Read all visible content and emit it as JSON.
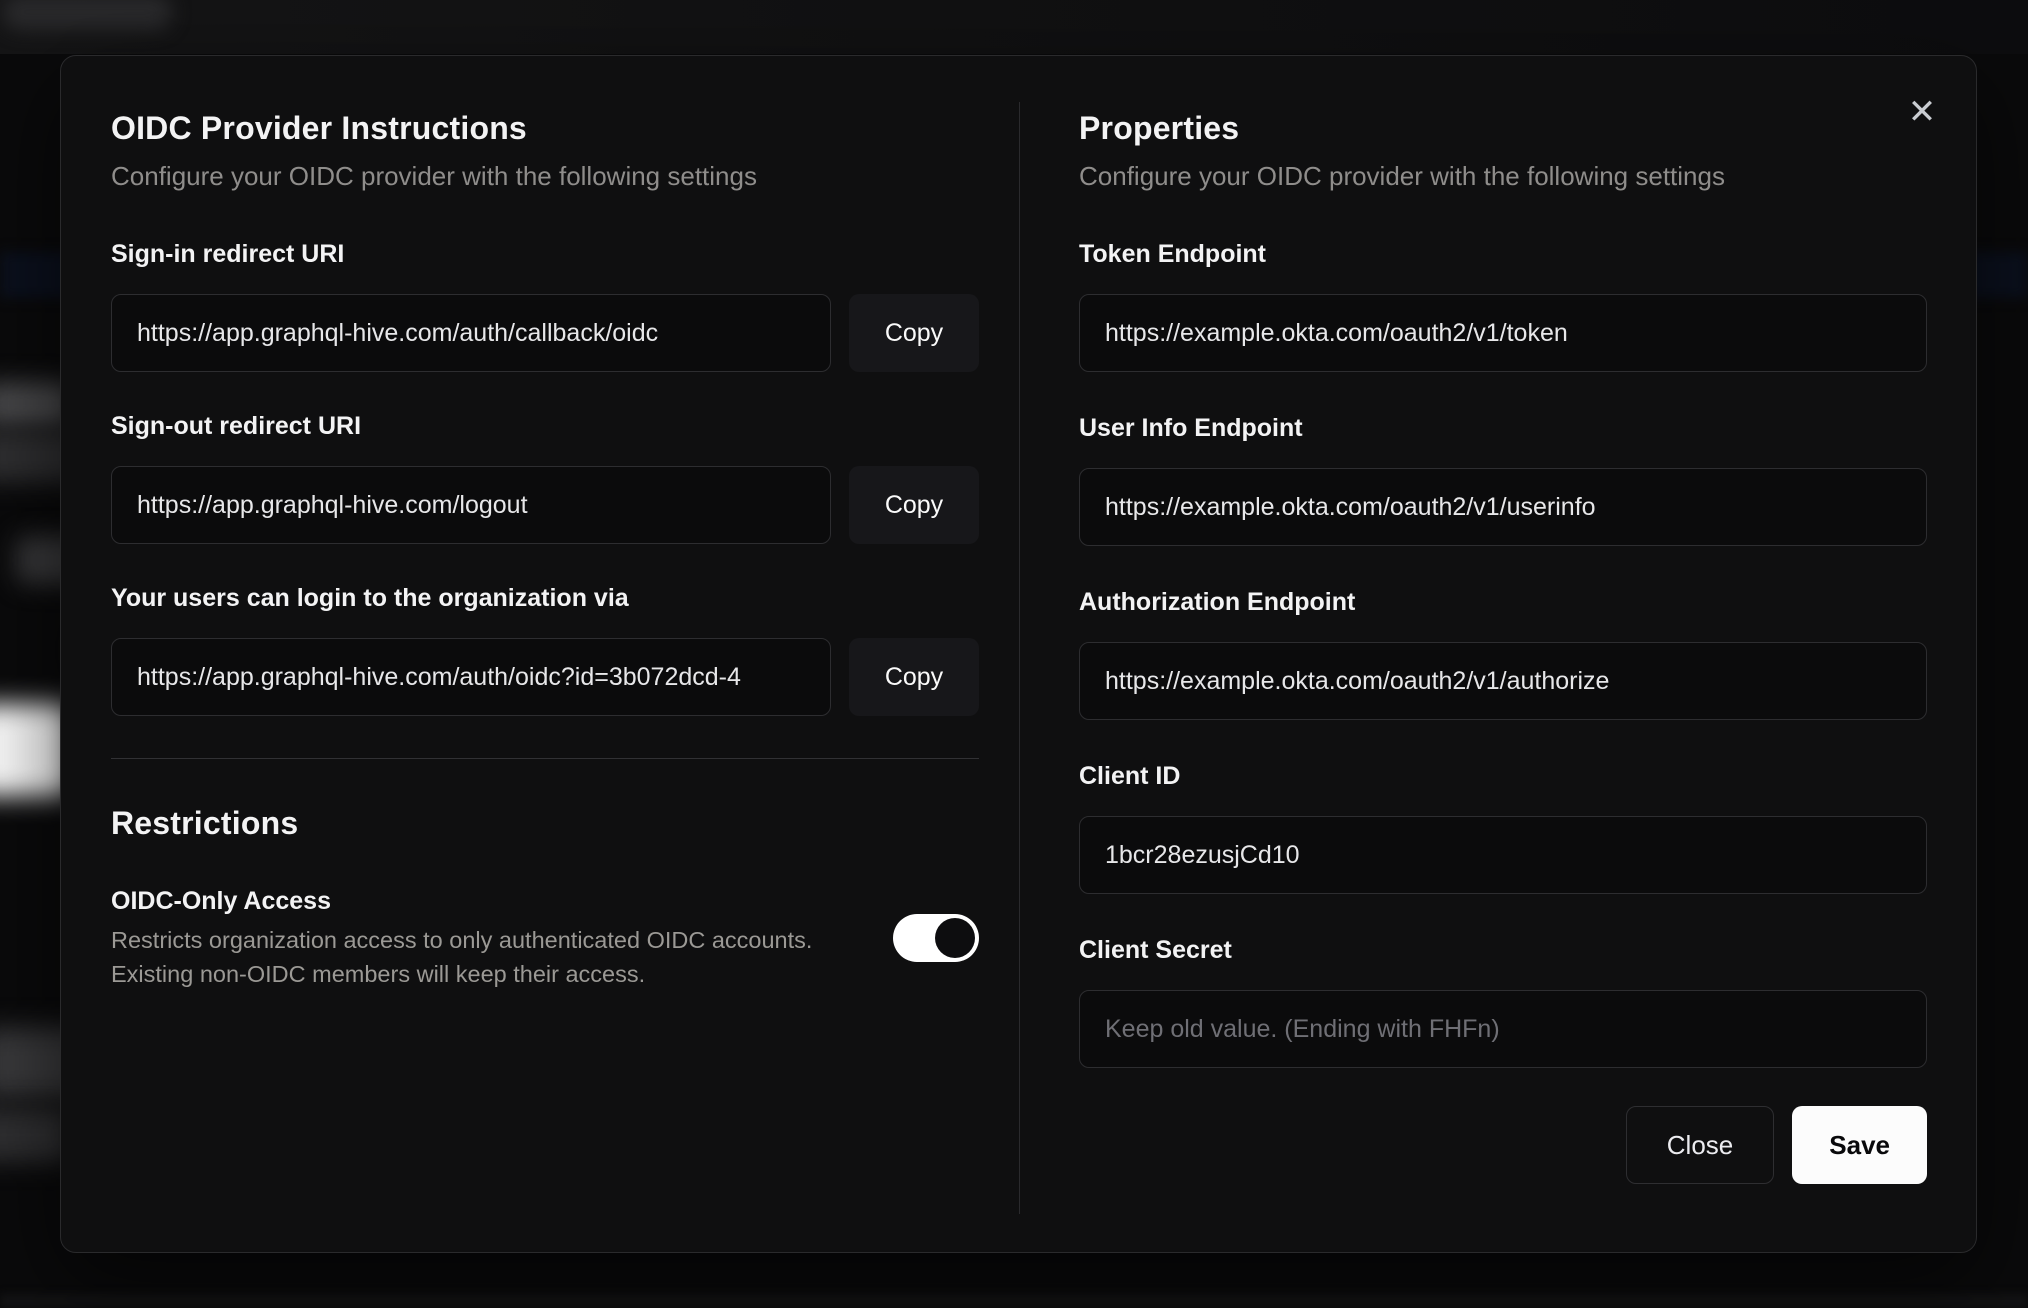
{
  "dialog": {
    "icons": {
      "close": "✕"
    },
    "instructions": {
      "title": "OIDC Provider Instructions",
      "subtitle": "Configure your OIDC provider with the following settings",
      "fields": [
        {
          "label": "Sign-in redirect URI",
          "value": "https://app.graphql-hive.com/auth/callback/oidc",
          "button": "Copy"
        },
        {
          "label": "Sign-out redirect URI",
          "value": "https://app.graphql-hive.com/logout",
          "button": "Copy"
        },
        {
          "label": "Your users can login to the organization via",
          "value": "https://app.graphql-hive.com/auth/oidc?id=3b072dcd-4",
          "button": "Copy"
        }
      ]
    },
    "restrictions": {
      "title": "Restrictions",
      "oidc_only": {
        "label": "OIDC-Only Access",
        "description": "Restricts organization access to only authenticated OIDC accounts. Existing non-OIDC members will keep their access.",
        "enabled": true
      }
    },
    "properties": {
      "title": "Properties",
      "subtitle": "Configure your OIDC provider with the following settings",
      "fields": [
        {
          "label": "Token Endpoint",
          "value": "https://example.okta.com/oauth2/v1/token"
        },
        {
          "label": "User Info Endpoint",
          "value": "https://example.okta.com/oauth2/v1/userinfo"
        },
        {
          "label": "Authorization Endpoint",
          "value": "https://example.okta.com/oauth2/v1/authorize"
        },
        {
          "label": "Client ID",
          "value": "1bcr28ezusjCd10"
        },
        {
          "label": "Client Secret",
          "value": "",
          "placeholder": "Keep old value. (Ending with FHFn)"
        }
      ]
    },
    "actions": {
      "close_label": "Close",
      "save_label": "Save"
    },
    "colors": {
      "page_background": "#0a0a0b",
      "modal_background": "#0f0f10",
      "modal_border": "#2a2a2c",
      "input_background": "#0b0b0c",
      "input_border": "#2d2d30",
      "heading_text": "#f3f3f4",
      "muted_text": "#8f8d8b",
      "save_button": "#fcfcfc",
      "toggle_on": "#ffffff"
    }
  }
}
